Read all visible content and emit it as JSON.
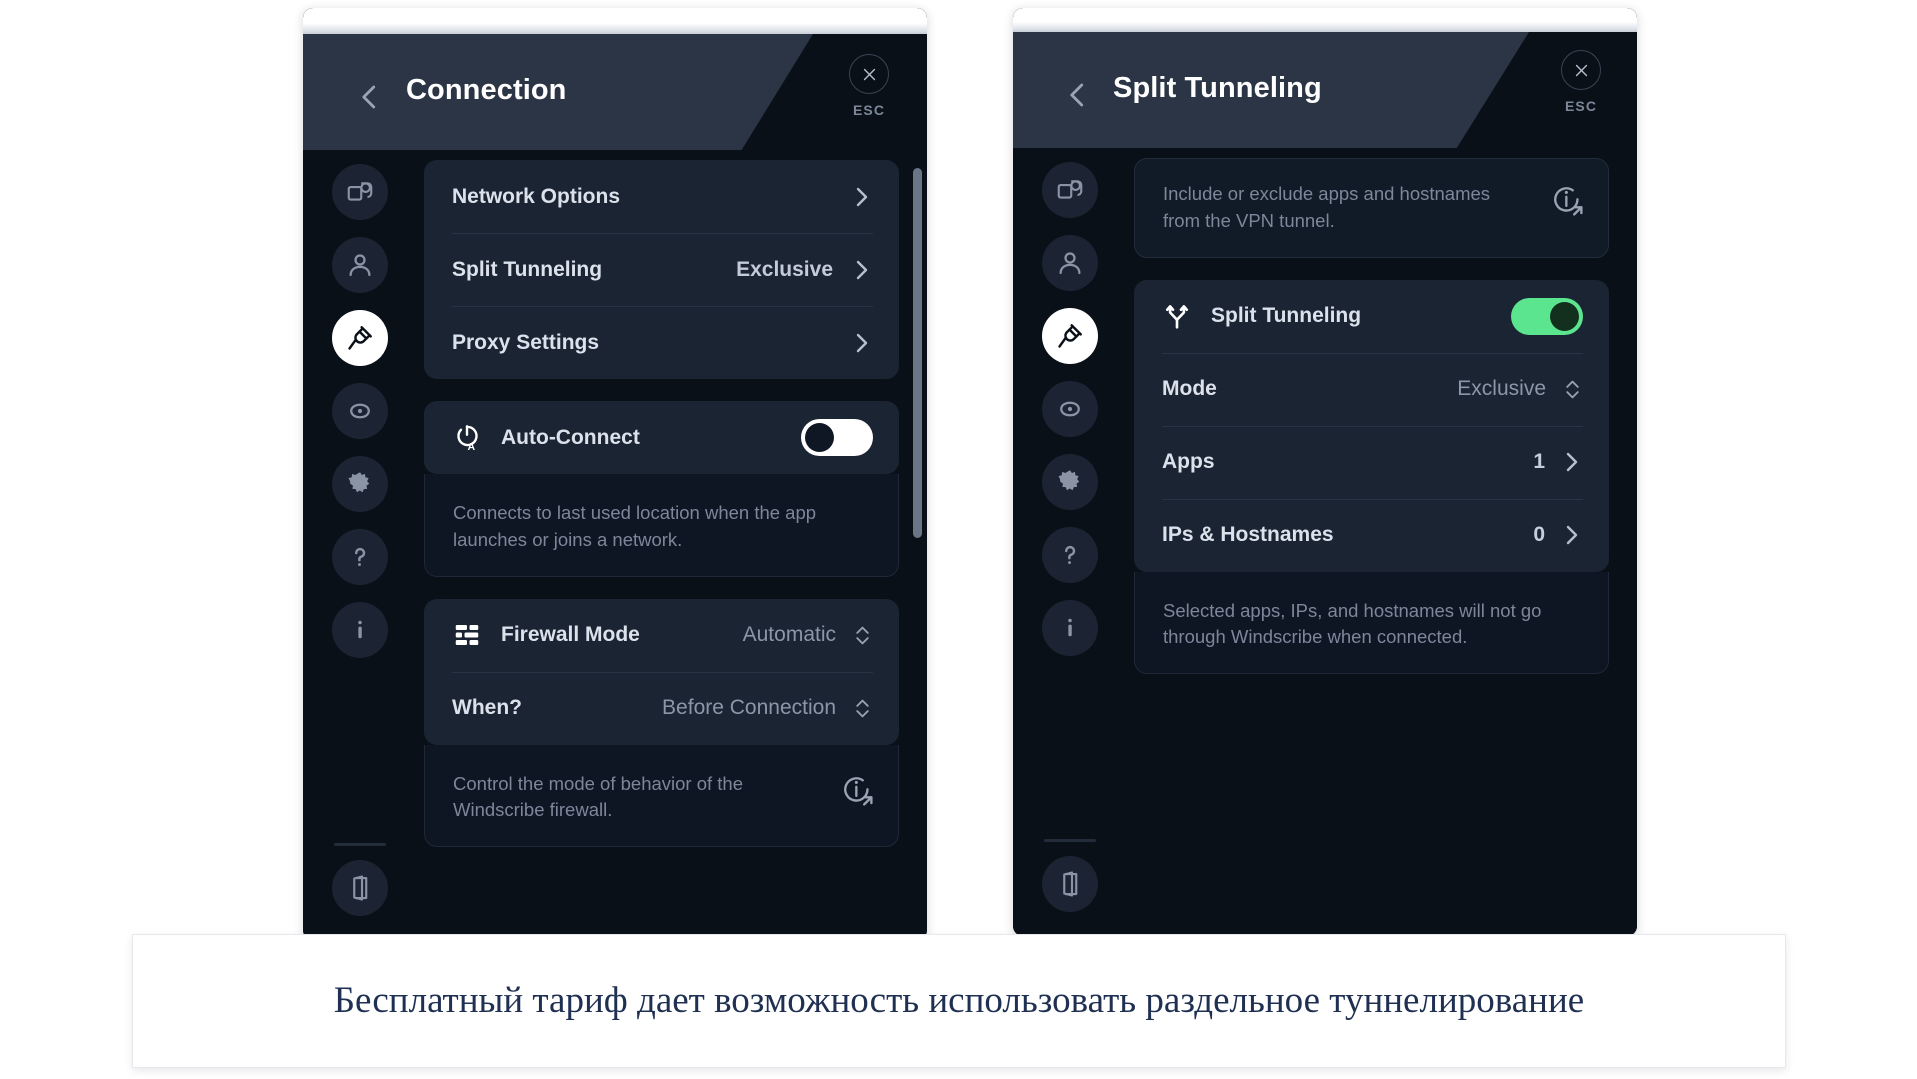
{
  "app": {
    "name": "Windscribe",
    "accent_green": "#5CE58F",
    "page_bg": "#0A1018",
    "card_bg": "#1B2433",
    "header_bg": "#2C3545",
    "caption_color": "#1F3052"
  },
  "sidebar": {
    "items": [
      {
        "name": "general",
        "icon": "windows-icon",
        "active": false
      },
      {
        "name": "account",
        "icon": "person-icon",
        "active": false
      },
      {
        "name": "connection",
        "icon": "plug-icon",
        "active": true
      },
      {
        "name": "robert",
        "icon": "robot-eye-icon",
        "active": false
      },
      {
        "name": "preferences",
        "icon": "gear-icon",
        "active": false
      },
      {
        "name": "help",
        "icon": "question-mark-icon",
        "active": false
      },
      {
        "name": "about",
        "icon": "info-letter-icon",
        "active": false
      },
      {
        "name": "logout",
        "icon": "exit-door-icon",
        "active": false
      }
    ]
  },
  "left_panel": {
    "header": {
      "title": "Connection",
      "back_icon": "chevron-left-icon",
      "close_icon": "close-x-icon",
      "esc_label": "ESC"
    },
    "menu_card": {
      "rows": [
        {
          "label": "Network Options",
          "value": "",
          "chevron": true
        },
        {
          "label": "Split Tunneling",
          "value": "Exclusive",
          "chevron": true
        },
        {
          "label": "Proxy Settings",
          "value": "",
          "chevron": true
        }
      ]
    },
    "auto_connect": {
      "icon": "power-auto-icon",
      "label": "Auto-Connect",
      "toggle_state": "off",
      "description": "Connects to last used location when the app launches or joins a network."
    },
    "firewall": {
      "icon": "firewall-bars-icon",
      "label": "Firewall Mode",
      "mode_value": "Automatic",
      "when_label": "When?",
      "when_value": "Before Connection",
      "description": "Control the mode of behavior of the Windscribe firewall.",
      "info_icon": "info-external-icon"
    }
  },
  "right_panel": {
    "header": {
      "title": "Split Tunneling",
      "back_icon": "chevron-left-icon",
      "close_icon": "close-x-icon",
      "esc_label": "ESC"
    },
    "intro_note": {
      "text": "Include or exclude apps and hostnames from the VPN tunnel.",
      "info_icon": "info-external-icon"
    },
    "split_tunneling": {
      "icon": "split-fork-icon",
      "label": "Split Tunneling",
      "toggle_state": "on"
    },
    "settings_rows": [
      {
        "label": "Mode",
        "value": "Exclusive",
        "control": "stepper"
      },
      {
        "label": "Apps",
        "value": "1",
        "control": "chevron"
      },
      {
        "label": "IPs & Hostnames",
        "value": "0",
        "control": "chevron"
      }
    ],
    "footer_note": "Selected apps, IPs, and hostnames will not go through Windscribe when connected."
  },
  "caption": {
    "text": "Бесплатный тариф дает возможность использовать раздельное туннелирование"
  }
}
